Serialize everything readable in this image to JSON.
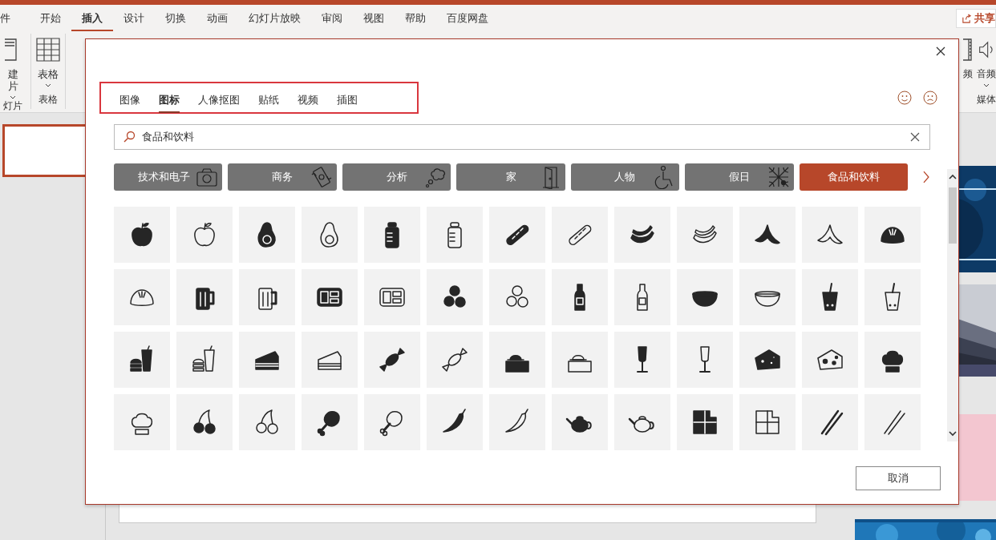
{
  "ribbon": {
    "tabs": [
      {
        "label": "件",
        "selected": false
      },
      {
        "label": "开始",
        "selected": false
      },
      {
        "label": "插入",
        "selected": true
      },
      {
        "label": "设计",
        "selected": false
      },
      {
        "label": "切换",
        "selected": false
      },
      {
        "label": "动画",
        "selected": false
      },
      {
        "label": "幻灯片放映",
        "selected": false
      },
      {
        "label": "审阅",
        "selected": false
      },
      {
        "label": "视图",
        "selected": false
      },
      {
        "label": "帮助",
        "selected": false
      },
      {
        "label": "百度网盘",
        "selected": false
      }
    ],
    "share_button": "共享",
    "left_groups": [
      {
        "label": "灯片",
        "commands": [
          {
            "kind": "slide",
            "lines": [
              "建",
              "片"
            ],
            "dropdown": true
          }
        ]
      },
      {
        "label": "表格",
        "commands": [
          {
            "kind": "table",
            "lines": [
              "表格"
            ],
            "dropdown": true
          }
        ]
      }
    ],
    "right_group": {
      "label": "媒体",
      "commands": [
        {
          "kind": "video",
          "lines": [
            "频"
          ],
          "dropdown": false
        },
        {
          "kind": "audio",
          "lines": [
            "音频"
          ],
          "dropdown": true
        }
      ]
    }
  },
  "dialog": {
    "tabs": [
      {
        "label": "图像",
        "selected": false
      },
      {
        "label": "图标",
        "selected": true
      },
      {
        "label": "人像抠图",
        "selected": false
      },
      {
        "label": "贴纸",
        "selected": false
      },
      {
        "label": "视频",
        "selected": false
      },
      {
        "label": "插图",
        "selected": false
      }
    ],
    "search": {
      "value": "食品和饮料"
    },
    "categories": [
      {
        "label": "技术和电子",
        "kind": "camera",
        "selected": false
      },
      {
        "label": "商务",
        "kind": "money",
        "selected": false
      },
      {
        "label": "分析",
        "kind": "thought",
        "selected": false
      },
      {
        "label": "家",
        "kind": "door",
        "selected": false
      },
      {
        "label": "人物",
        "kind": "wheelchair",
        "selected": false
      },
      {
        "label": "假日",
        "kind": "web",
        "selected": false
      },
      {
        "label": "食品和饮料",
        "kind": "none",
        "selected": true
      }
    ],
    "cancel_button": "取消"
  }
}
